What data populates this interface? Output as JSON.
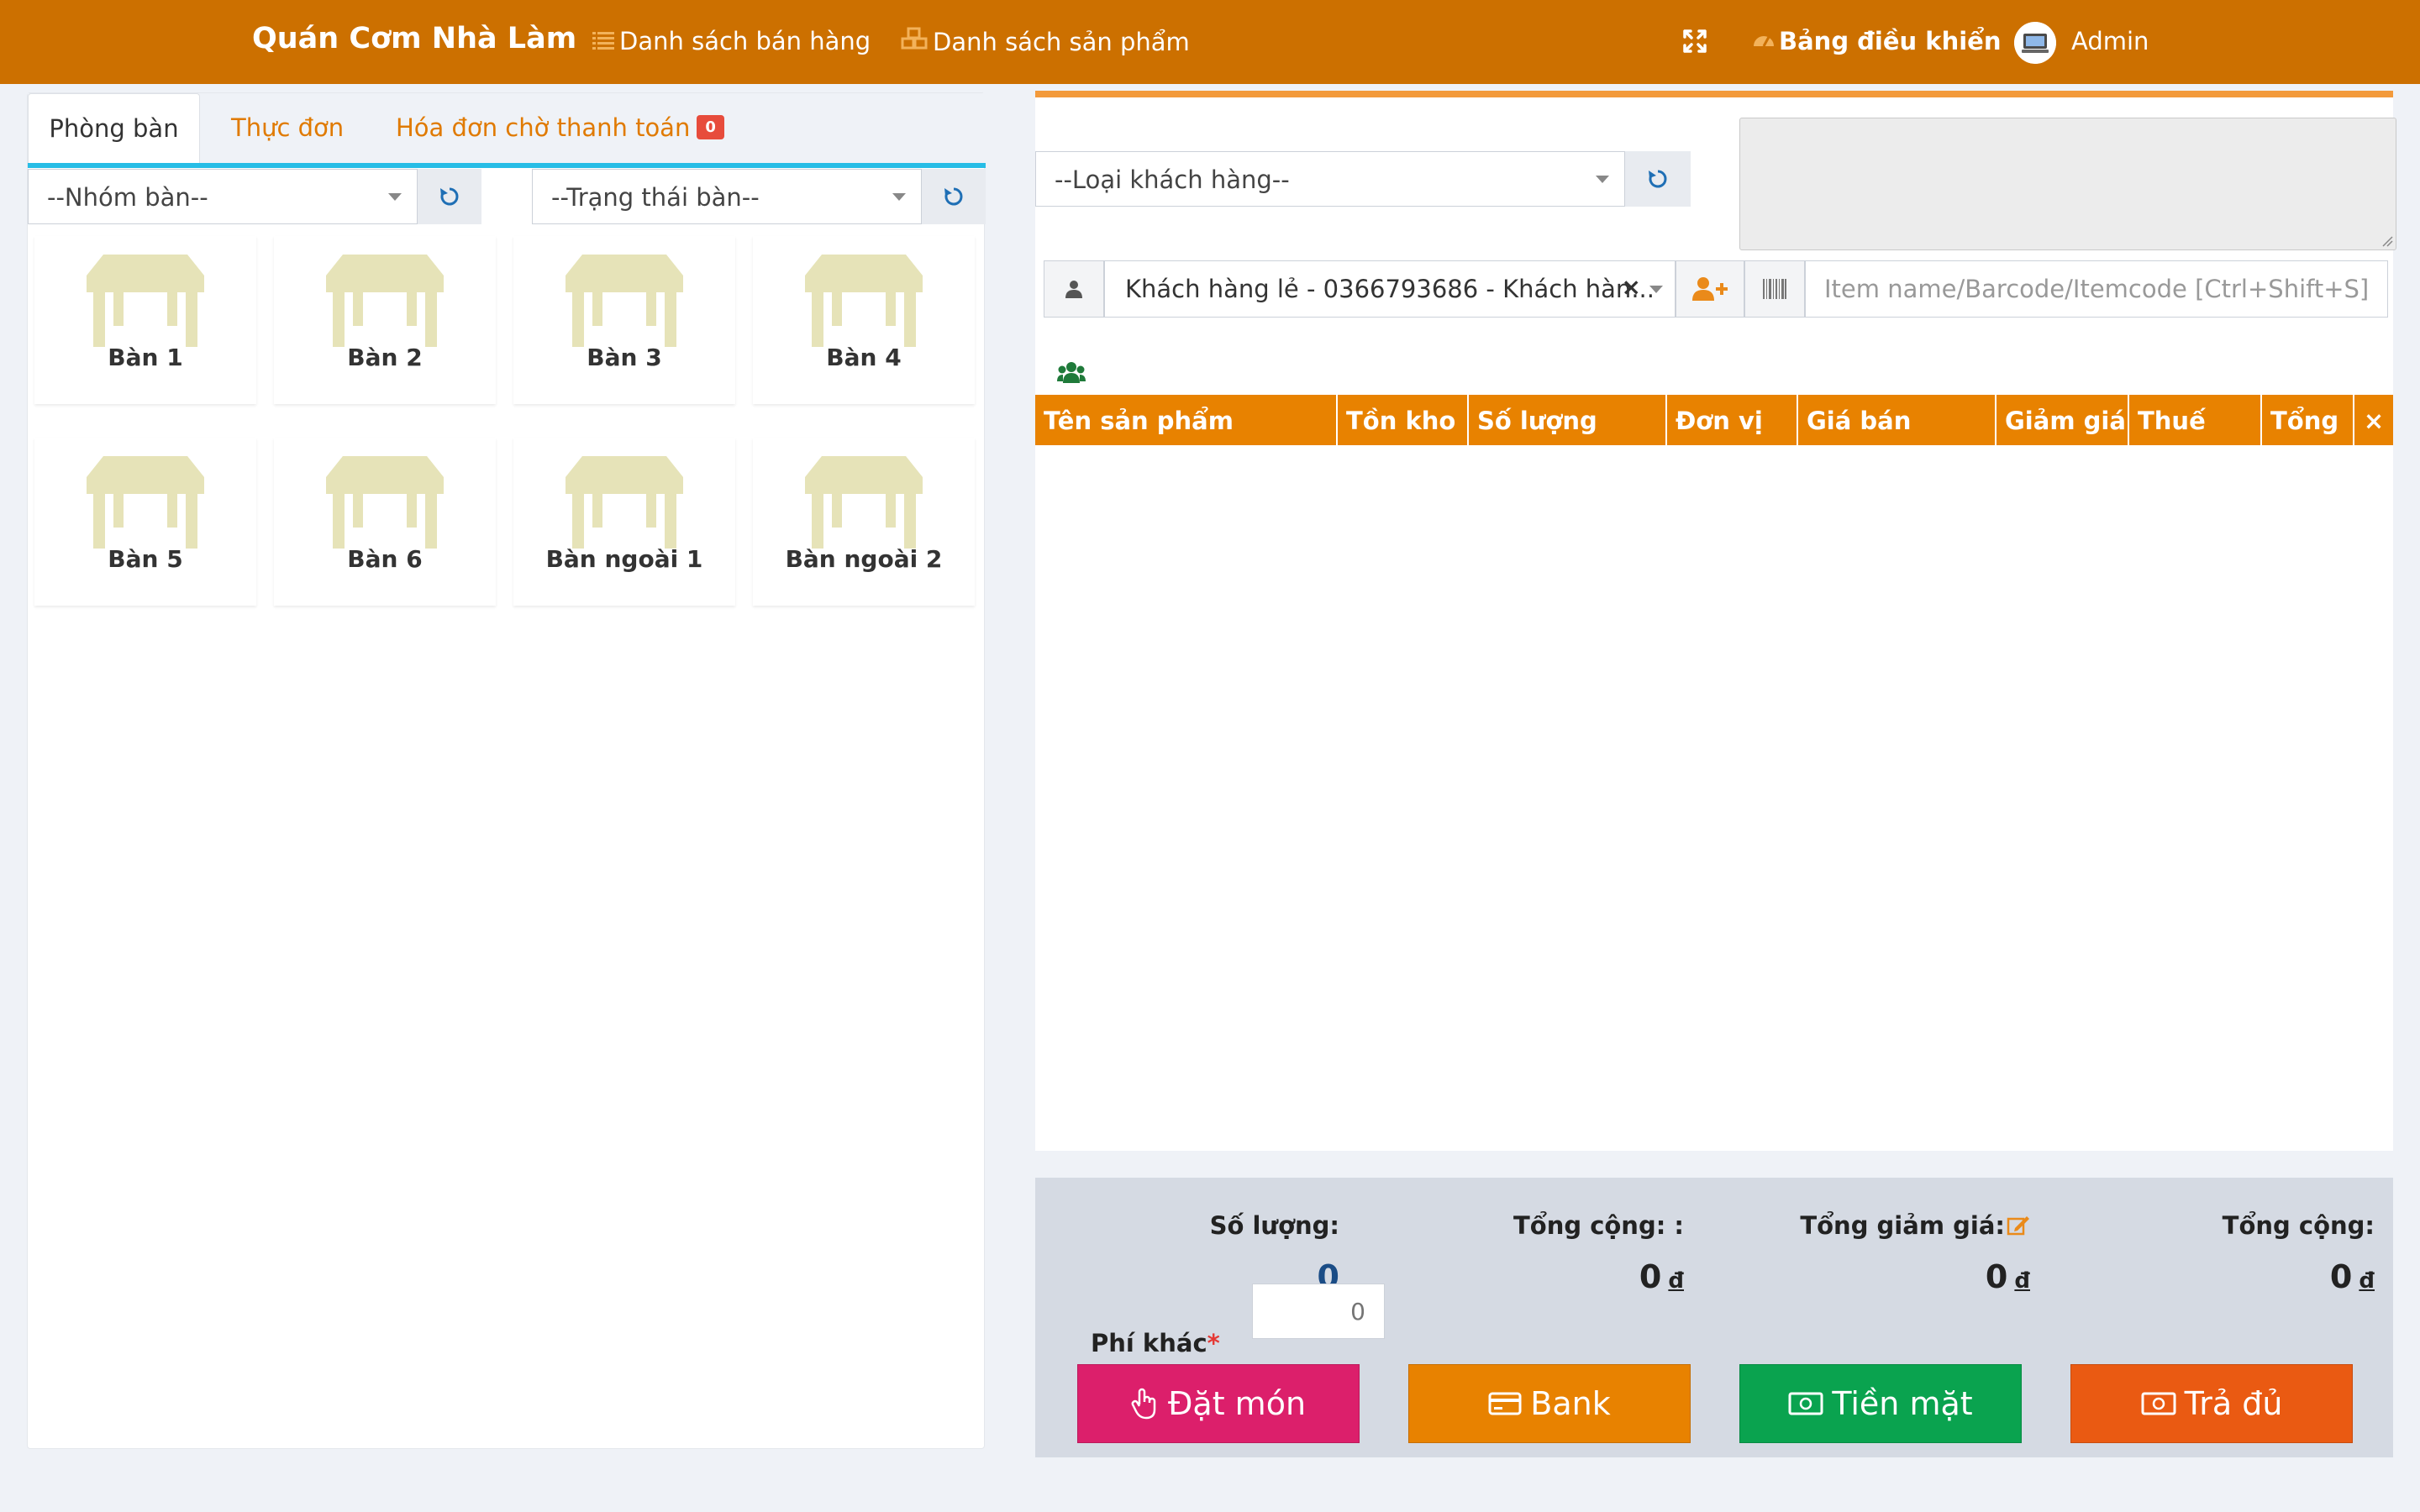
{
  "header": {
    "brand": "Quán Cơm Nhà Làm",
    "nav_sales": "Danh sách bán hàng",
    "nav_products": "Danh sách sản phẩm",
    "dashboard": "Bảng điều khiển",
    "user": "Admin"
  },
  "left": {
    "tabs": {
      "rooms": "Phòng bàn",
      "menu": "Thực đơn",
      "pending": "Hóa đơn chờ thanh toán",
      "pending_count": "0"
    },
    "filters": {
      "group": "--Nhóm bàn--",
      "status": "--Trạng thái bàn--"
    },
    "tables": [
      "Bàn 1",
      "Bàn 2",
      "Bàn 3",
      "Bàn 4",
      "Bàn 5",
      "Bàn 6",
      "Bàn ngoài 1",
      "Bàn ngoài 2"
    ]
  },
  "right": {
    "customer_type": "--Loại khách hàng--",
    "customer": "Khách hàng lẻ - 0366793686 - Khách hàn...",
    "search_placeholder": "Item name/Barcode/Itemcode [Ctrl+Shift+S]",
    "columns": [
      "Tên sản phẩm",
      "Tồn kho",
      "Số lượng",
      "Đơn vị",
      "Giá bán",
      "Giảm giá",
      "Thuế",
      "Tổng"
    ],
    "remove_all": "×"
  },
  "summary": {
    "qty_label": "Số lượng:",
    "qty_value": "0",
    "subtotal_label": "Tổng cộng: :",
    "subtotal_value": "0",
    "discount_label": "Tổng giảm giá:",
    "discount_value": "0",
    "total_label": "Tổng cộng:",
    "total_value": "0",
    "currency": "đ",
    "fee_label": "Phí khác",
    "fee_required": "*",
    "fee_placeholder": "0"
  },
  "actions": {
    "order": "Đặt món",
    "bank": "Bank",
    "cash": "Tiền mặt",
    "pay_full": "Trả đủ"
  },
  "colors": {
    "topbar": "#cc7000",
    "grid_header": "#e88200",
    "order_btn": "#dc1f6b",
    "bank_btn": "#e88200",
    "cash_btn": "#0aa34f",
    "pay_btn": "#ea5a12"
  }
}
